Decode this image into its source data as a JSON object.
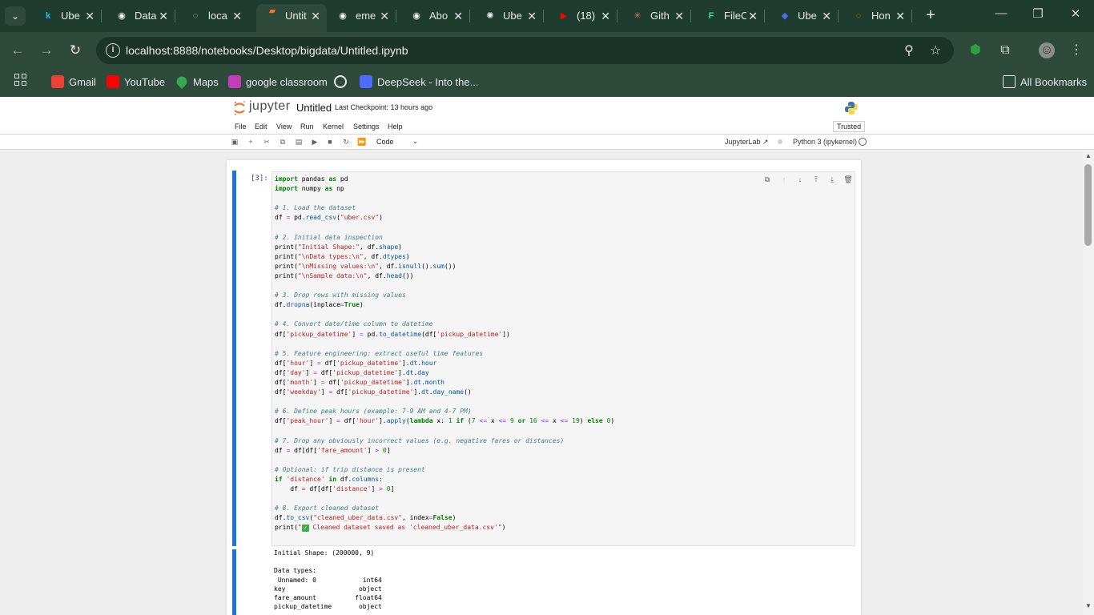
{
  "browser": {
    "tabs": [
      {
        "label": "Ube",
        "icon": "kaggle-icon",
        "icon_glyph": "k",
        "icon_color": "#20beff",
        "active": false
      },
      {
        "label": "Data",
        "icon": "github-icon",
        "icon_glyph": "◉",
        "icon_color": "#ffffff",
        "active": false
      },
      {
        "label": "loca",
        "icon": "loading-icon",
        "icon_glyph": "◌",
        "icon_color": "#c8c8c8",
        "active": false
      },
      {
        "label": "Untit",
        "icon": "jupyter-file-icon",
        "icon_glyph": "▰",
        "icon_color": "#f37726",
        "active": true
      },
      {
        "label": "eme",
        "icon": "github-icon",
        "icon_glyph": "◉",
        "icon_color": "#ffffff",
        "active": false
      },
      {
        "label": "Abo",
        "icon": "github-icon",
        "icon_glyph": "◉",
        "icon_color": "#ffffff",
        "active": false
      },
      {
        "label": "Ube",
        "icon": "chatgpt-icon",
        "icon_glyph": "✺",
        "icon_color": "#e8eaed",
        "active": false
      },
      {
        "label": "(18)",
        "icon": "youtube-icon",
        "icon_glyph": "▶",
        "icon_color": "#ff0000",
        "active": false
      },
      {
        "label": "Gith",
        "icon": "claude-icon",
        "icon_glyph": "✳",
        "icon_color": "#d97757",
        "active": false
      },
      {
        "label": "FileC",
        "icon": "file-icon",
        "icon_glyph": "F",
        "icon_color": "#3ddc97",
        "active": false
      },
      {
        "label": "Ube",
        "icon": "deepseek-icon",
        "icon_glyph": "◆",
        "icon_color": "#4d6bfe",
        "active": false
      },
      {
        "label": "Hon",
        "icon": "loading-icon",
        "icon_glyph": "◌",
        "icon_color": "#f28c38",
        "active": false
      }
    ],
    "url": "localhost:8888/notebooks/Desktop/bigdata/Untitled.ipynb",
    "bookmarks": [
      {
        "label": "Gmail",
        "color": "#ea4335",
        "icon": "gmail-icon"
      },
      {
        "label": "YouTube",
        "color": "#ff0000",
        "icon": "youtube-icon"
      },
      {
        "label": "Maps",
        "color": "#34a853",
        "icon": "maps-icon"
      },
      {
        "label": "google classroom",
        "color": "#c33eb8",
        "icon": "classroom-icon"
      },
      {
        "label": "",
        "color": "#e8eaed",
        "icon": "chatgpt-icon"
      },
      {
        "label": "DeepSeek - Into the...",
        "color": "#4d6bfe",
        "icon": "deepseek-icon"
      }
    ],
    "all_bookmarks": "All Bookmarks"
  },
  "jupyter": {
    "logo_text": "jupyter",
    "notebook_title": "Untitled",
    "checkpoint": "Last Checkpoint: 13 hours ago",
    "menus": [
      "File",
      "Edit",
      "View",
      "Run",
      "Kernel",
      "Settings",
      "Help"
    ],
    "trusted": "Trusted",
    "cell_type": "Code",
    "jupyterlab_link": "JupyterLab",
    "kernel_name": "Python 3 (ipykernel)"
  },
  "cell": {
    "prompt": "[3]:",
    "output_lines": [
      "Initial Shape: (200000, 9)",
      "",
      "Data types:",
      " Unnamed: 0            int64",
      "key                   object",
      "fare_amount          float64",
      "pickup_datetime       object"
    ]
  }
}
